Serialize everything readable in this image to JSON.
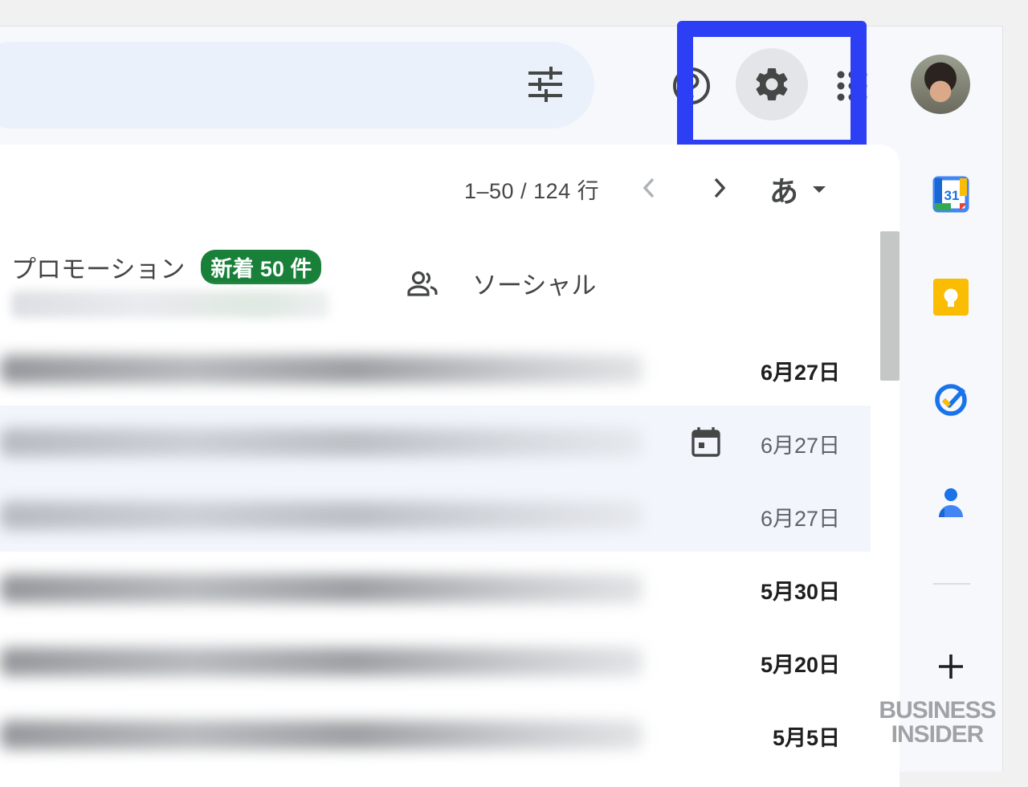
{
  "toolbar": {
    "filter_icon": "tune-icon",
    "help_icon": "help-circle-icon",
    "settings_icon": "gear-icon",
    "apps_icon": "apps-grid-icon",
    "avatar": "user-avatar"
  },
  "highlight_color": "#2c3ff5",
  "list": {
    "pager_text": "1–50 / 124 行",
    "input_tool_label": "あ"
  },
  "tabs": {
    "promotions": {
      "label": "プロモーション",
      "badge": "新着 50 件"
    },
    "social": {
      "label": "ソーシャル"
    }
  },
  "emails": [
    {
      "date": "6月27日",
      "unread": true,
      "calendar": false
    },
    {
      "date": "6月27日",
      "unread": false,
      "calendar": true
    },
    {
      "date": "6月27日",
      "unread": false,
      "calendar": false
    },
    {
      "date": "5月30日",
      "unread": true,
      "calendar": false
    },
    {
      "date": "5月20日",
      "unread": true,
      "calendar": false
    },
    {
      "date": "5月5日",
      "unread": true,
      "calendar": false
    }
  ],
  "side_panel": {
    "calendar_day": "31",
    "apps": [
      "google-calendar-icon",
      "google-keep-icon",
      "google-tasks-icon",
      "google-contacts-icon"
    ],
    "add_icon": "plus-icon"
  },
  "watermark": {
    "line1": "BUSINESS",
    "line2": "INSIDER"
  },
  "colors": {
    "badge_green": "#188038",
    "calendar_blue": "#4285f4",
    "keep_yellow": "#fbbc04",
    "tasks_blue": "#1a73e8"
  }
}
